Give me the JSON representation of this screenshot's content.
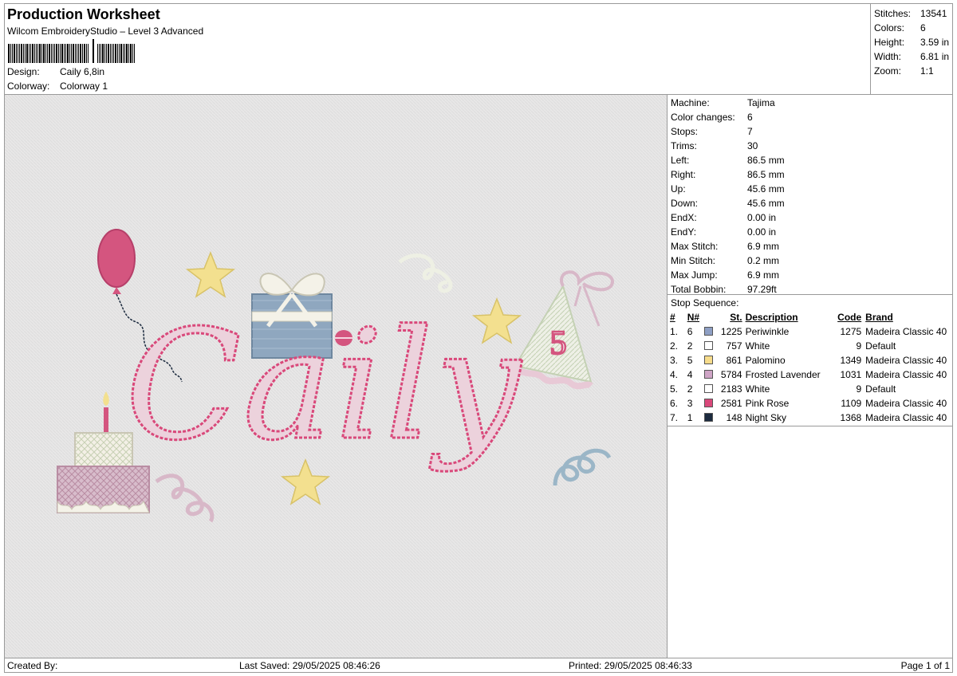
{
  "header": {
    "title": "Production Worksheet",
    "subtitle": "Wilcom EmbroideryStudio – Level 3 Advanced",
    "design_label": "Design:",
    "design_value": "Caily 6,8in",
    "colorway_label": "Colorway:",
    "colorway_value": "Colorway 1"
  },
  "summary": [
    {
      "label": "Stitches:",
      "value": "13541"
    },
    {
      "label": "Colors:",
      "value": "6"
    },
    {
      "label": "Height:",
      "value": "3.59 in"
    },
    {
      "label": "Width:",
      "value": "6.81 in"
    },
    {
      "label": "Zoom:",
      "value": "1:1"
    }
  ],
  "machine_info": [
    {
      "label": "Machine:",
      "value": "Tajima"
    },
    {
      "label": "Color changes:",
      "value": "6"
    },
    {
      "label": "Stops:",
      "value": "7"
    },
    {
      "label": "Trims:",
      "value": "30"
    },
    {
      "label": "Left:",
      "value": "86.5 mm"
    },
    {
      "label": "Right:",
      "value": "86.5 mm"
    },
    {
      "label": "Up:",
      "value": "45.6 mm"
    },
    {
      "label": "Down:",
      "value": "45.6 mm"
    },
    {
      "label": "EndX:",
      "value": "0.00 in"
    },
    {
      "label": "EndY:",
      "value": "0.00 in"
    },
    {
      "label": "Max Stitch:",
      "value": "6.9 mm"
    },
    {
      "label": "Min Stitch:",
      "value": "0.2 mm"
    },
    {
      "label": "Max Jump:",
      "value": "6.9 mm"
    },
    {
      "label": "Total Bobbin:",
      "value": "97.29ft"
    }
  ],
  "stop_sequence": {
    "caption": "Stop Sequence:",
    "headers": {
      "num": "#",
      "n": "N#",
      "st": "St.",
      "desc": "Description",
      "code": "Code",
      "brand": "Brand"
    },
    "rows": [
      {
        "num": "1.",
        "n": "6",
        "color": "#8e9fc4",
        "st": "1225",
        "desc": "Periwinkle",
        "code": "1275",
        "brand": "Madeira Classic 40"
      },
      {
        "num": "2.",
        "n": "2",
        "color": "#ffffff",
        "st": "757",
        "desc": "White",
        "code": "9",
        "brand": "Default"
      },
      {
        "num": "3.",
        "n": "5",
        "color": "#f7dc8b",
        "st": "861",
        "desc": "Palomino",
        "code": "1349",
        "brand": "Madeira Classic 40"
      },
      {
        "num": "4.",
        "n": "4",
        "color": "#cfa5c6",
        "st": "5784",
        "desc": "Frosted Lavender",
        "code": "1031",
        "brand": "Madeira Classic 40"
      },
      {
        "num": "5.",
        "n": "2",
        "color": "#ffffff",
        "st": "2183",
        "desc": "White",
        "code": "9",
        "brand": "Default"
      },
      {
        "num": "6.",
        "n": "3",
        "color": "#d9487a",
        "st": "2581",
        "desc": "Pink Rose",
        "code": "1109",
        "brand": "Madeira Classic 40"
      },
      {
        "num": "7.",
        "n": "1",
        "color": "#1c2b3f",
        "st": "148",
        "desc": "Night Sky",
        "code": "1368",
        "brand": "Madeira Classic 40"
      }
    ]
  },
  "preview": {
    "name_text": "Caily",
    "hat_number": "5"
  },
  "footer": {
    "created_by": "Created By:",
    "last_saved": "Last Saved: 29/05/2025 08:46:26",
    "printed": "Printed: 29/05/2025 08:46:33",
    "page": "Page 1 of 1"
  }
}
